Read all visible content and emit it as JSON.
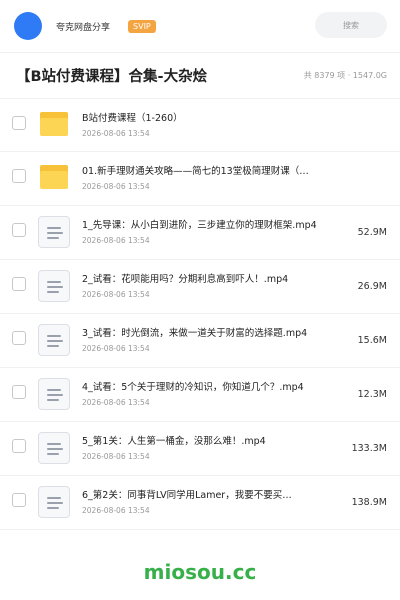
{
  "header": {
    "username": "夸克网盘分享",
    "badge": "SVIP",
    "search_label": "搜索"
  },
  "folder": {
    "title": "【B站付费课程】合集-大杂烩",
    "meta": "共 8379 项 · 1547.0G"
  },
  "files": [
    {
      "type": "folder",
      "name": "B站付费课程（1-260）",
      "date": "2026-08-06 13:54",
      "size": ""
    },
    {
      "type": "folder",
      "name": "01.新手理财通关攻略——简七的13堂极简理财课（…",
      "date": "2026-08-06 13:54",
      "size": ""
    },
    {
      "type": "video",
      "name": "1_先导课：从小白到进阶，三步建立你的理财框架.mp4",
      "date": "2026-08-06 13:54",
      "size": "52.9M"
    },
    {
      "type": "video",
      "name": "2_试看：花呗能用吗？分期利息高到吓人！.mp4",
      "date": "2026-08-06 13:54",
      "size": "26.9M"
    },
    {
      "type": "video",
      "name": "3_试看：时光倒流，来做一道关于财富的选择题.mp4",
      "date": "2026-08-06 13:54",
      "size": "15.6M"
    },
    {
      "type": "video",
      "name": "4_试看：5个关于理财的冷知识，你知道几个？.mp4",
      "date": "2026-08-06 13:54",
      "size": "12.3M"
    },
    {
      "type": "video",
      "name": "5_第1关：人生第一桶金，没那么难！.mp4",
      "date": "2026-08-06 13:54",
      "size": "133.3M"
    },
    {
      "type": "video",
      "name": "6_第2关：同事背LV同学用Lamer，我要不要买…",
      "date": "2026-08-06 13:54",
      "size": "138.9M"
    }
  ],
  "watermark": "miosou.cc",
  "colors": {
    "avatar": "#2f7bf5",
    "badge": "#f5a442",
    "folder": "#fbd553",
    "watermark": "#38b04a"
  }
}
